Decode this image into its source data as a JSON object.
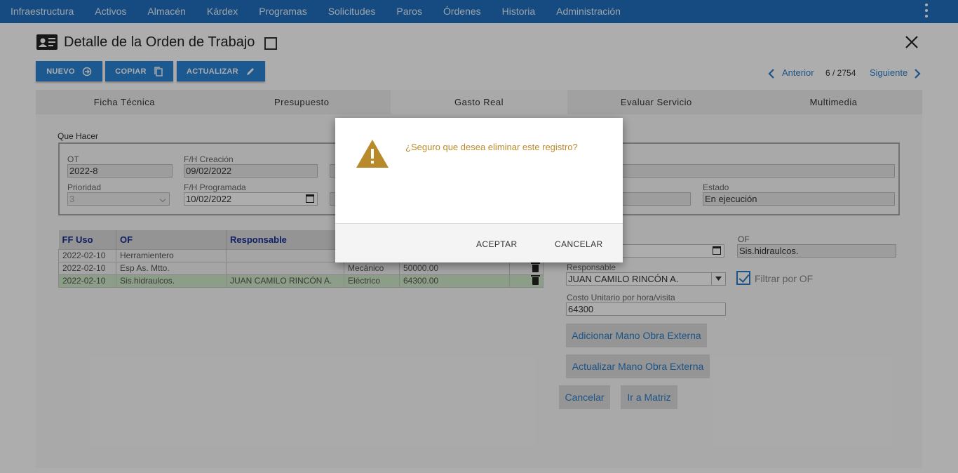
{
  "nav": {
    "items": [
      "Infraestructura",
      "Activos",
      "Almacén",
      "Kárdex",
      "Programas",
      "Solicitudes",
      "Paros",
      "Órdenes",
      "Historia",
      "Administración"
    ]
  },
  "header": {
    "title": "Detalle de la Orden de Trabajo",
    "buttons": {
      "new": "NUEVO",
      "copy": "COPIAR",
      "update": "ACTUALIZAR"
    },
    "pager": {
      "prev": "Anterior",
      "count": "6 / 2754",
      "next": "Siguiente"
    }
  },
  "tabs": [
    "Ficha Técnica",
    "Presupuesto",
    "Gasto Real",
    "Evaluar Servicio",
    "Multimedia"
  ],
  "active_tab": "Gasto Real",
  "form": {
    "legend": "Que Hacer",
    "ot_label": "OT",
    "ot_value": "2022-8",
    "fh_creacion_label": "F/H Creación",
    "fh_creacion_value": "09/02/2022",
    "prioridad_label": "Prioridad",
    "prioridad_value": "3",
    "fh_programada_label": "F/H Programada",
    "fh_programada_value": "10/02/2022",
    "estado_label": "Estado",
    "estado_value": "En ejecución"
  },
  "table": {
    "headers": [
      "FF Uso",
      "OF",
      "Responsable"
    ],
    "rows": [
      {
        "ff": "2022-02-10",
        "of": "Herramientero",
        "resp": "",
        "tipo": "",
        "valor": ""
      },
      {
        "ff": "2022-02-10",
        "of": "Esp As. Mtto.",
        "resp": "",
        "tipo": "Mecánico",
        "valor": "50000.00"
      },
      {
        "ff": "2022-02-10",
        "of": "Sis.hidraulcos.",
        "resp": "JUAN CAMILO RINCÓN A.",
        "tipo": "Eléctrico",
        "valor": "64300.00"
      }
    ]
  },
  "right_form": {
    "of_label": "OF",
    "of_value": "Sis.hidraulcos.",
    "responsable_label": "Responsable",
    "responsable_value": "JUAN CAMILO RINCÓN A.",
    "filtrar_label": "Filtrar por OF",
    "costo_label": "Costo Unitario por hora/visita",
    "costo_value": "64300",
    "btn_adicionar": "Adicionar Mano Obra Externa",
    "btn_actualizar": "Actualizar Mano Obra Externa",
    "btn_cancelar": "Cancelar",
    "btn_matriz": "Ir a Matriz"
  },
  "modal": {
    "message": "¿Seguro que desea eliminar este registro?",
    "accept": "ACEPTAR",
    "cancel": "CANCELAR"
  },
  "colors": {
    "nav": "#1f6fbf",
    "button": "#2a83d6",
    "link": "#2a7cc9",
    "warning": "#b98a2a"
  }
}
